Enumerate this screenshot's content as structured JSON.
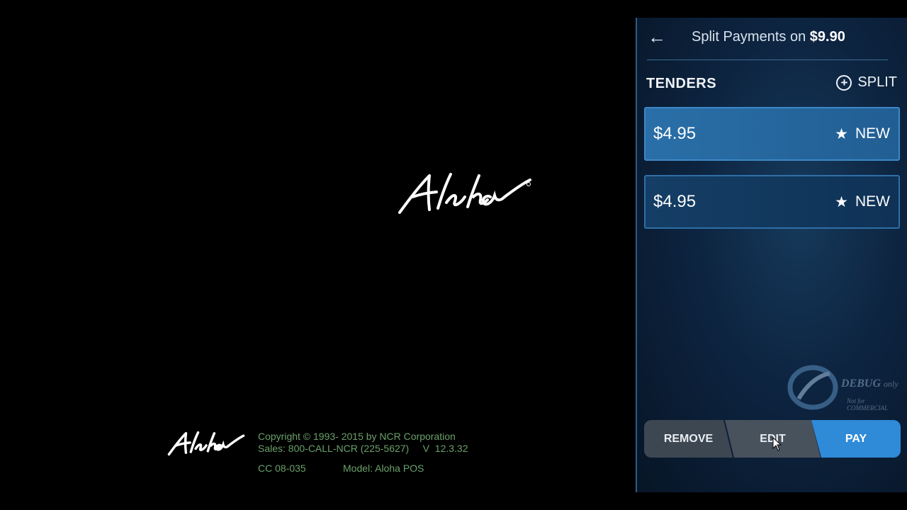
{
  "splash": {
    "logo_text": "Aloha",
    "copyright": "Copyright © 1993- 2015 by NCR Corporation",
    "sales": "Sales: 800-CALL-NCR (225-5627)     V  12.3.32",
    "cc": "CC 08-035",
    "model": "Model: Aloha POS"
  },
  "panel": {
    "title_prefix": "Split Payments on",
    "title_amount": "$9.90",
    "back_icon": "left-arrow-icon",
    "section_label": "TENDERS",
    "split_label": "SPLIT",
    "tenders": [
      {
        "amount": "$4.95",
        "status": "NEW"
      },
      {
        "amount": "$4.95",
        "status": "NEW"
      }
    ],
    "watermark": {
      "main": "DEBUG",
      "suffix": "only",
      "sub": "Not for COMMERCIAL"
    },
    "buttons": {
      "remove": "REMOVE",
      "edit": "EDIT",
      "pay": "PAY"
    }
  },
  "colors": {
    "accent": "#2f8ad8",
    "panel_bg": "#0d2440",
    "copy_text": "#6aa06a"
  }
}
